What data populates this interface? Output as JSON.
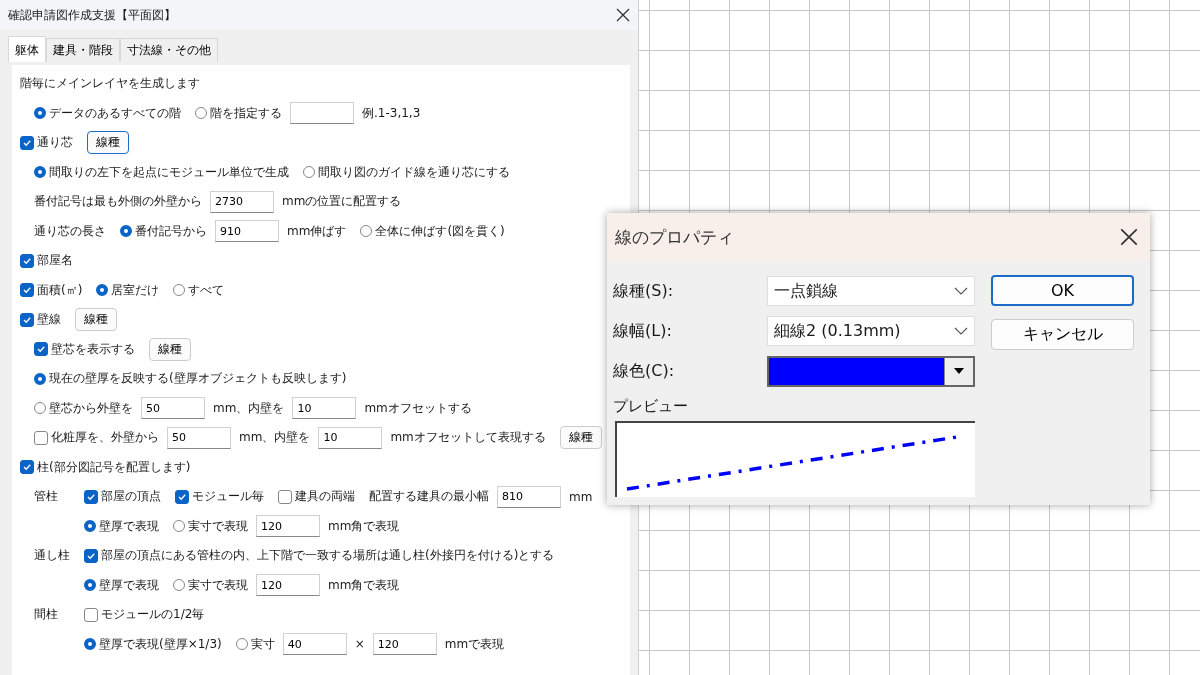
{
  "main_window": {
    "title": "確認申請図作成支援【平面図】",
    "tabs": [
      {
        "label": "躯体",
        "selected": true
      },
      {
        "label": "建具・階段",
        "selected": false
      },
      {
        "label": "寸法線・その他",
        "selected": false
      }
    ],
    "rows": [
      {
        "items": [
          {
            "kind": "text",
            "text": "階毎にメインレイヤを生成します"
          }
        ],
        "children": [
          {
            "items": [
              {
                "kind": "radio",
                "label": "データのあるすべての階",
                "selected": true
              },
              {
                "kind": "radio",
                "label": "階を指定する",
                "selected": false
              },
              {
                "kind": "field",
                "value": ""
              },
              {
                "kind": "text",
                "text": "例.1-3,1,3"
              }
            ]
          }
        ]
      },
      {
        "items": [
          {
            "kind": "checkbox",
            "label": "通り芯",
            "checked": true
          },
          {
            "kind": "button",
            "label": "線種",
            "focused": true
          }
        ],
        "children": [
          {
            "items": [
              {
                "kind": "radio",
                "label": "間取りの左下を起点にモジュール単位で生成",
                "selected": true
              },
              {
                "kind": "radio",
                "label": "間取り図のガイド線を通り芯にする",
                "selected": false
              }
            ]
          },
          {
            "items": [
              {
                "kind": "text",
                "text": "番付記号は最も外側の外壁から"
              },
              {
                "kind": "field",
                "value": "2730"
              },
              {
                "kind": "text",
                "text": "mmの位置に配置する"
              }
            ]
          },
          {
            "items": [
              {
                "kind": "text",
                "text": "通り芯の長さ"
              },
              {
                "kind": "radio",
                "label": "番付記号から",
                "selected": true
              },
              {
                "kind": "field",
                "value": "910"
              },
              {
                "kind": "text",
                "text": "mm伸ばす"
              },
              {
                "kind": "radio",
                "label": "全体に伸ばす(図を貫く)",
                "selected": false
              }
            ]
          }
        ]
      },
      {
        "items": [
          {
            "kind": "checkbox",
            "label": "部屋名",
            "checked": true
          }
        ]
      },
      {
        "items": [
          {
            "kind": "checkbox",
            "label": "面積(㎡)",
            "checked": true
          },
          {
            "kind": "radio",
            "label": "居室だけ",
            "selected": true
          },
          {
            "kind": "radio",
            "label": "すべて",
            "selected": false
          }
        ]
      },
      {
        "items": [
          {
            "kind": "checkbox",
            "label": "壁線",
            "checked": true
          },
          {
            "kind": "button",
            "label": "線種",
            "focused": false
          }
        ],
        "children": [
          {
            "items": [
              {
                "kind": "checkbox",
                "label": "壁芯を表示する",
                "checked": true
              },
              {
                "kind": "button",
                "label": "線種",
                "focused": false
              }
            ]
          },
          {
            "items": [
              {
                "kind": "radio",
                "label": "現在の壁厚を反映する(壁厚オブジェクトも反映します)",
                "selected": true
              }
            ]
          },
          {
            "items": [
              {
                "kind": "radio",
                "label": "壁芯から外壁を",
                "selected": false
              },
              {
                "kind": "field",
                "value": "50"
              },
              {
                "kind": "text",
                "text": "mm、内壁を"
              },
              {
                "kind": "field",
                "value": "10"
              },
              {
                "kind": "text",
                "text": "mmオフセットする"
              }
            ]
          },
          {
            "items": [
              {
                "kind": "checkbox",
                "label": "化粧厚を、外壁から",
                "checked": false
              },
              {
                "kind": "field",
                "value": "50"
              },
              {
                "kind": "text",
                "text": "mm、内壁を"
              },
              {
                "kind": "field",
                "value": "10"
              },
              {
                "kind": "text",
                "text": "mmオフセットして表現する"
              },
              {
                "kind": "button",
                "label": "線種",
                "focused": false
              }
            ]
          }
        ]
      },
      {
        "items": [
          {
            "kind": "checkbox",
            "label": "柱(部分図記号を配置します)",
            "checked": true
          }
        ],
        "children": [
          {
            "label": "管柱",
            "lines": [
              [
                {
                  "kind": "checkbox",
                  "label": "部屋の頂点",
                  "checked": true
                },
                {
                  "kind": "checkbox",
                  "label": "モジュール毎",
                  "checked": true
                },
                {
                  "kind": "checkbox",
                  "label": "建具の両端",
                  "checked": false
                },
                {
                  "kind": "text",
                  "text": "配置する建具の最小幅"
                },
                {
                  "kind": "field",
                  "value": "810"
                },
                {
                  "kind": "text",
                  "text": "mm"
                }
              ],
              [
                {
                  "kind": "radio",
                  "label": "壁厚で表現",
                  "selected": true
                },
                {
                  "kind": "radio",
                  "label": "実寸で表現",
                  "selected": false
                },
                {
                  "kind": "field",
                  "value": "120"
                },
                {
                  "kind": "text",
                  "text": "mm角で表現"
                }
              ]
            ]
          },
          {
            "label": "通し柱",
            "lines": [
              [
                {
                  "kind": "checkbox",
                  "label": "部屋の頂点にある管柱の内、上下階で一致する場所は通し柱(外接円を付ける)とする",
                  "checked": true
                }
              ],
              [
                {
                  "kind": "radio",
                  "label": "壁厚で表現",
                  "selected": true
                },
                {
                  "kind": "radio",
                  "label": "実寸で表現",
                  "selected": false
                },
                {
                  "kind": "field",
                  "value": "120"
                },
                {
                  "kind": "text",
                  "text": "mm角で表現"
                }
              ]
            ]
          },
          {
            "label": "間柱",
            "lines": [
              [
                {
                  "kind": "checkbox",
                  "label": "モジュールの1/2毎",
                  "checked": false
                }
              ],
              [
                {
                  "kind": "radio",
                  "label": "壁厚で表現(壁厚×1/3)",
                  "selected": true
                },
                {
                  "kind": "radio",
                  "label": "実寸",
                  "selected": false
                },
                {
                  "kind": "field",
                  "value": "40"
                },
                {
                  "kind": "text",
                  "text": "×"
                },
                {
                  "kind": "field",
                  "value": "120"
                },
                {
                  "kind": "text",
                  "text": "mmで表現"
                }
              ]
            ]
          }
        ]
      }
    ]
  },
  "dialog": {
    "title": "線のプロパティ",
    "fields": [
      {
        "kind": "dropdown",
        "label": "線種(S):",
        "value": "一点鎖線"
      },
      {
        "kind": "dropdown",
        "label": "線幅(L):",
        "value": "細線2 (0.13mm)"
      },
      {
        "kind": "color",
        "label": "線色(C):",
        "color": "#0000ff"
      }
    ],
    "preview_label": "プレビュー",
    "buttons": [
      {
        "label": "OK",
        "focused": true
      },
      {
        "label": "キャンセル",
        "focused": false
      }
    ]
  }
}
